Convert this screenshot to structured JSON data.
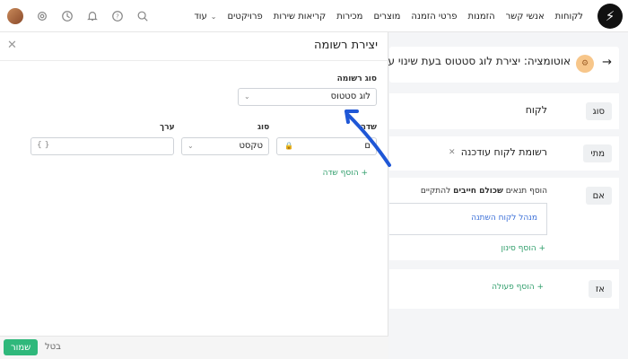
{
  "nav": {
    "items": [
      "לקוחות",
      "אנשי קשר",
      "הזמנות",
      "פרטי הזמנה",
      "מוצרים",
      "מכירות",
      "קריאות שירות",
      "פרויקטים"
    ],
    "more_label": "עוד"
  },
  "drawer": {
    "title": "יצירת רשומה",
    "record_type_label": "סוג רשומה",
    "record_type_value": "לוג סטטוס",
    "col_field": "שדה",
    "col_type": "סוג",
    "col_value": "ערך",
    "field_value": "ם",
    "type_value": "טקסט",
    "value_placeholder": "{ }",
    "add_field": "+ הוסף שדה",
    "save": "שמור",
    "cancel": "בטל"
  },
  "automation": {
    "title": "אוטומציה: יצירת לוג סטטוס בעת שינוי ע",
    "type_tag": "סוג",
    "type_value": "לקוח",
    "when_tag": "מתי",
    "when_value": "רשומת לקוח עודכנה",
    "if_tag": "אם",
    "if_hint_pre": "הוסף תנאים ",
    "if_hint_bold": "שכולם חייבים",
    "if_hint_post": " להתקיים",
    "condition_text": "מנהל לקוח השתנה",
    "add_filter": "+ הוסף סינון",
    "then_tag": "אז",
    "add_action": "+ הוסף פעולה"
  }
}
